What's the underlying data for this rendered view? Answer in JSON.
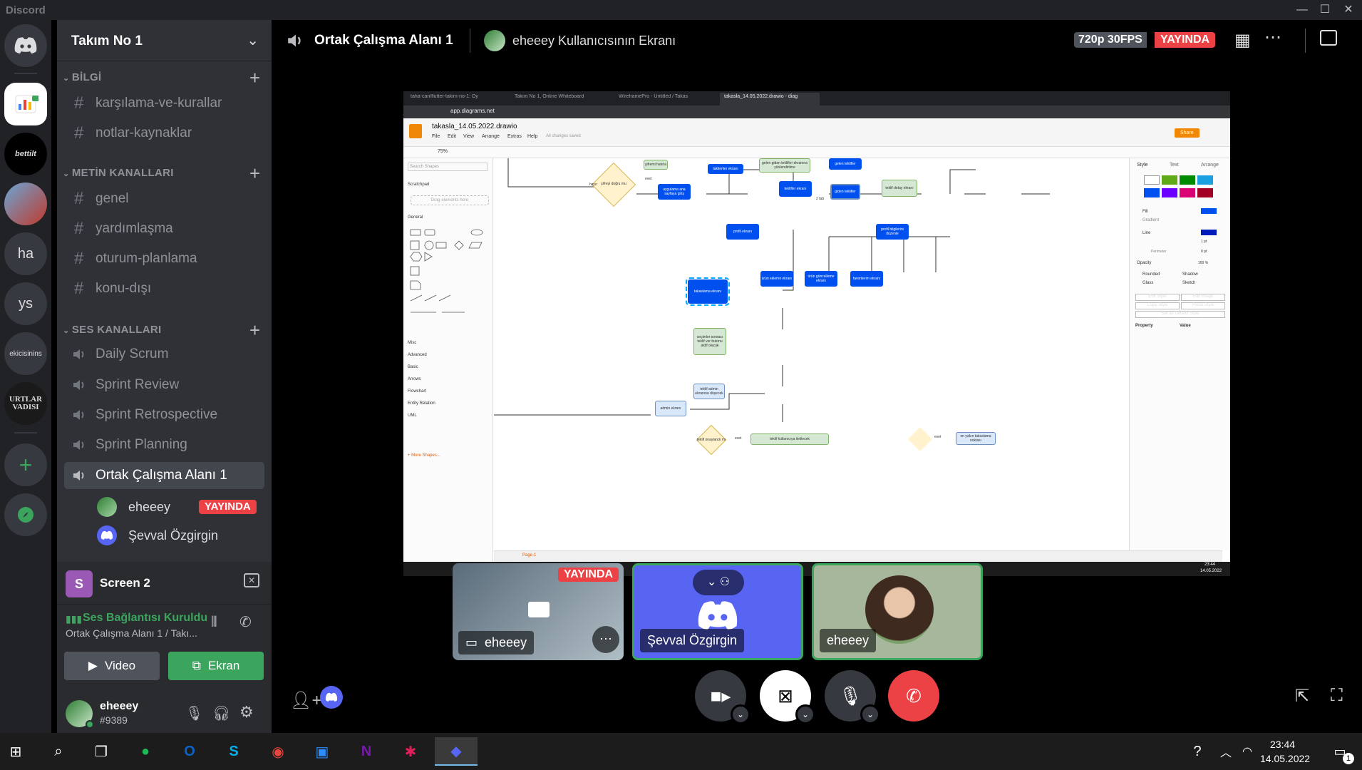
{
  "app": {
    "brand": "Discord"
  },
  "window_controls": {
    "minimize": "—",
    "maximize": "☐",
    "close": "✕"
  },
  "guilds": [
    {
      "label": "bettilt",
      "kind": "text"
    },
    {
      "label": "ha",
      "kind": "text"
    },
    {
      "label": "ys",
      "kind": "text"
    },
    {
      "label": "ekicisinins",
      "kind": "text"
    },
    {
      "label": "URTLAR VADISI",
      "kind": "text"
    }
  ],
  "server": {
    "name": "Takım No 1"
  },
  "categories": {
    "info": {
      "label": "BİLGİ",
      "channels": [
        "karşılama-ve-kurallar",
        "notlar-kaynaklar"
      ]
    },
    "text": {
      "label": "METİN KANALLARI",
      "channels": [
        "genel",
        "yardımlaşma",
        "oturum-planlama",
        "konu-dışı"
      ]
    },
    "voice": {
      "label": "SES KANALLARI",
      "channels": [
        "Daily Scrum",
        "Sprint Review",
        "Sprint Retrospective",
        "Sprint Planning",
        "Ortak Çalışma Alanı 1"
      ]
    }
  },
  "voice_users": [
    {
      "name": "eheeey",
      "badge": "YAYINDA"
    },
    {
      "name": "Şevval Özgirgin",
      "badge": ""
    }
  ],
  "screen_share": {
    "title": "Screen 2"
  },
  "voice_status": {
    "title": "Ses Bağlantısı Kuruldu",
    "subtitle": "Ortak Çalışma Alanı 1 / Takı..."
  },
  "panel_buttons": {
    "video": "Video",
    "screen": "Ekran"
  },
  "user": {
    "name": "eheeey",
    "tag": "#9389"
  },
  "call_header": {
    "channel": "Ortak Çalışma Alanı 1",
    "stream_title": "eheeey Kullanıcısının Ekranı",
    "quality": "720p 30FPS",
    "live": "YAYINDA"
  },
  "tiles": [
    {
      "name": "eheeey",
      "badge": "YAYINDA"
    },
    {
      "name": "Şevval Özgirgin",
      "badge": ""
    },
    {
      "name": "eheeey",
      "badge": ""
    }
  ],
  "drawio": {
    "tabs": [
      "taha-can/flutter-takim-no-1: Oy",
      "Takım No 1, Online Whiteboard",
      "WireframePro - Untitled / Takas",
      "takasla_14.05.2022.drawio - diag"
    ],
    "url": "app.diagrams.net",
    "filename": "takasla_14.05.2022.drawio",
    "menu": [
      "File",
      "Edit",
      "View",
      "Arrange",
      "Extras",
      "Help"
    ],
    "saved": "All changes saved",
    "share": "Share",
    "zoom": "75%",
    "search": "Search Shapes",
    "sections": [
      "Scratchpad",
      "General",
      "Misc",
      "Advanced",
      "Basic",
      "Arrows",
      "Flowchart",
      "Entity Relation",
      "UML"
    ],
    "drag_hint": "Drag elements here",
    "more_shapes": "+ More Shapes...",
    "page": "Page-1",
    "format_tabs": [
      "Style",
      "Text",
      "Arrange"
    ],
    "format_items": [
      "Fill",
      "Gradient",
      "Line",
      "Perimeter",
      "Opacity",
      "Rounded",
      "Shadow",
      "Glass",
      "Sketch"
    ],
    "format_values": {
      "line_width": "1 pt",
      "perimeter": "0 pt",
      "opacity": "100 %"
    },
    "format_buttons": [
      "Edit Style",
      "Edit Image",
      "Copy Style",
      "Paste Style",
      "Set as Default Style"
    ],
    "property_cols": [
      "Property",
      "Value"
    ],
    "nodes": {
      "n1": "şifreyi doğru mu",
      "n2": "uygulama ana sayfaya giriş",
      "n3": "şifremi hatırla",
      "n4": "takilenler ekranı",
      "n5": "gelen giden teklifler ekranına yönlendirilme",
      "n6": "teklifler ekranı",
      "n7": "gelen teklifler",
      "n8": "giden teklifler",
      "n9": "teklif detay ekranı",
      "n10": "profil ekranı",
      "n11": "profil bilgilerini düzenle",
      "n12": "ürün ekleme ekranı",
      "n13": "ürün güncelleme ekranı",
      "n14": "favorilerim ekranı",
      "n15": "takaslama ekranı",
      "n16": "seçimler sonrası teklif ver butonu aktif olacak",
      "n17": "teklif admin ekranına düşecek",
      "n18": "admin ekranı",
      "n19": "teklif onaylandı mı",
      "n20": "teklif kullanıcıya iletilecek",
      "n21": "en yakın takaslama noktası"
    },
    "edge_labels": [
      "hayır",
      "evet",
      "2 tab",
      "evet",
      "evet"
    ],
    "taskbar_time": "23:44",
    "taskbar_date": "14.05.2022"
  },
  "taskbar": {
    "time": "23:44",
    "date": "14.05.2022",
    "notif_count": "1"
  },
  "colors": {
    "blurple": "#5865f2",
    "green": "#3ba55d",
    "red": "#ed4245",
    "bg_dark": "#202225",
    "bg_channels": "#2f3136"
  }
}
